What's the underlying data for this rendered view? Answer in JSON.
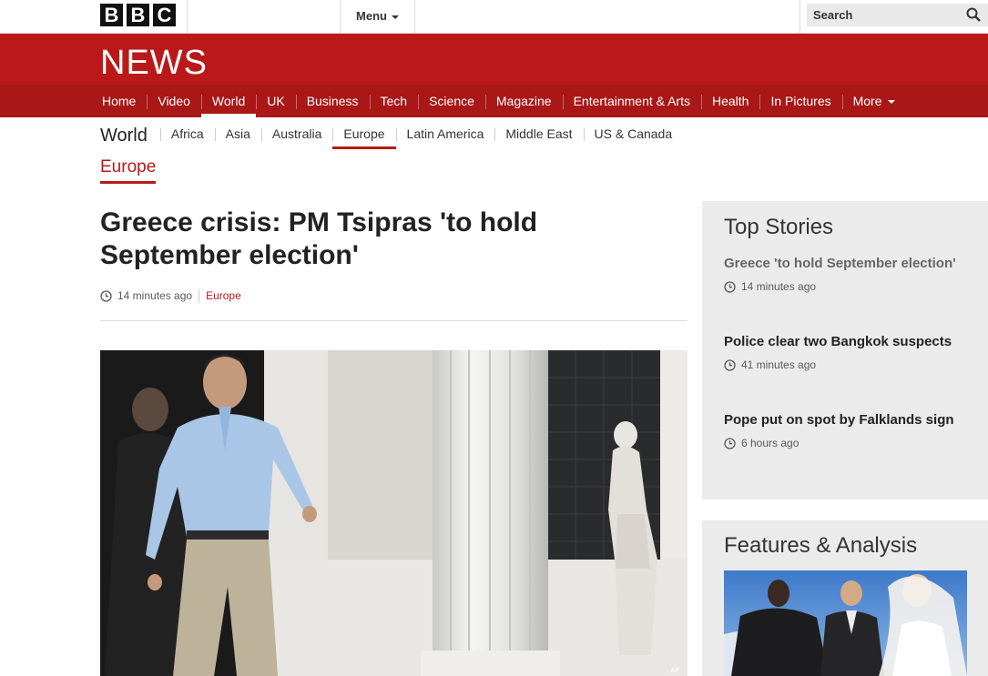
{
  "brand": {
    "logo_letters": [
      "B",
      "B",
      "C"
    ],
    "news_logo": "NEWS",
    "accent": "#bb1919"
  },
  "topbar": {
    "menu_label": "Menu",
    "search_placeholder": "Search"
  },
  "nav": {
    "items": [
      "Home",
      "Video",
      "World",
      "UK",
      "Business",
      "Tech",
      "Science",
      "Magazine",
      "Entertainment & Arts",
      "Health",
      "In Pictures",
      "More"
    ],
    "active": "World"
  },
  "subnav": {
    "section": "World",
    "items": [
      "Africa",
      "Asia",
      "Australia",
      "Europe",
      "Latin America",
      "Middle East",
      "US & Canada"
    ],
    "active": "Europe"
  },
  "page_section": "Europe",
  "article": {
    "headline": "Greece crisis: PM Tsipras 'to hold September election'",
    "time": "14 minutes ago",
    "section": "Europe",
    "photo_credit": "AP"
  },
  "top_stories": {
    "title": "Top Stories",
    "stories": [
      {
        "title": "Greece 'to hold September election'",
        "time": "14 minutes ago"
      },
      {
        "title": "Police clear two Bangkok suspects",
        "time": "41 minutes ago"
      },
      {
        "title": "Pope put on spot by Falklands sign",
        "time": "6 hours ago"
      }
    ]
  },
  "features": {
    "title": "Features & Analysis"
  }
}
